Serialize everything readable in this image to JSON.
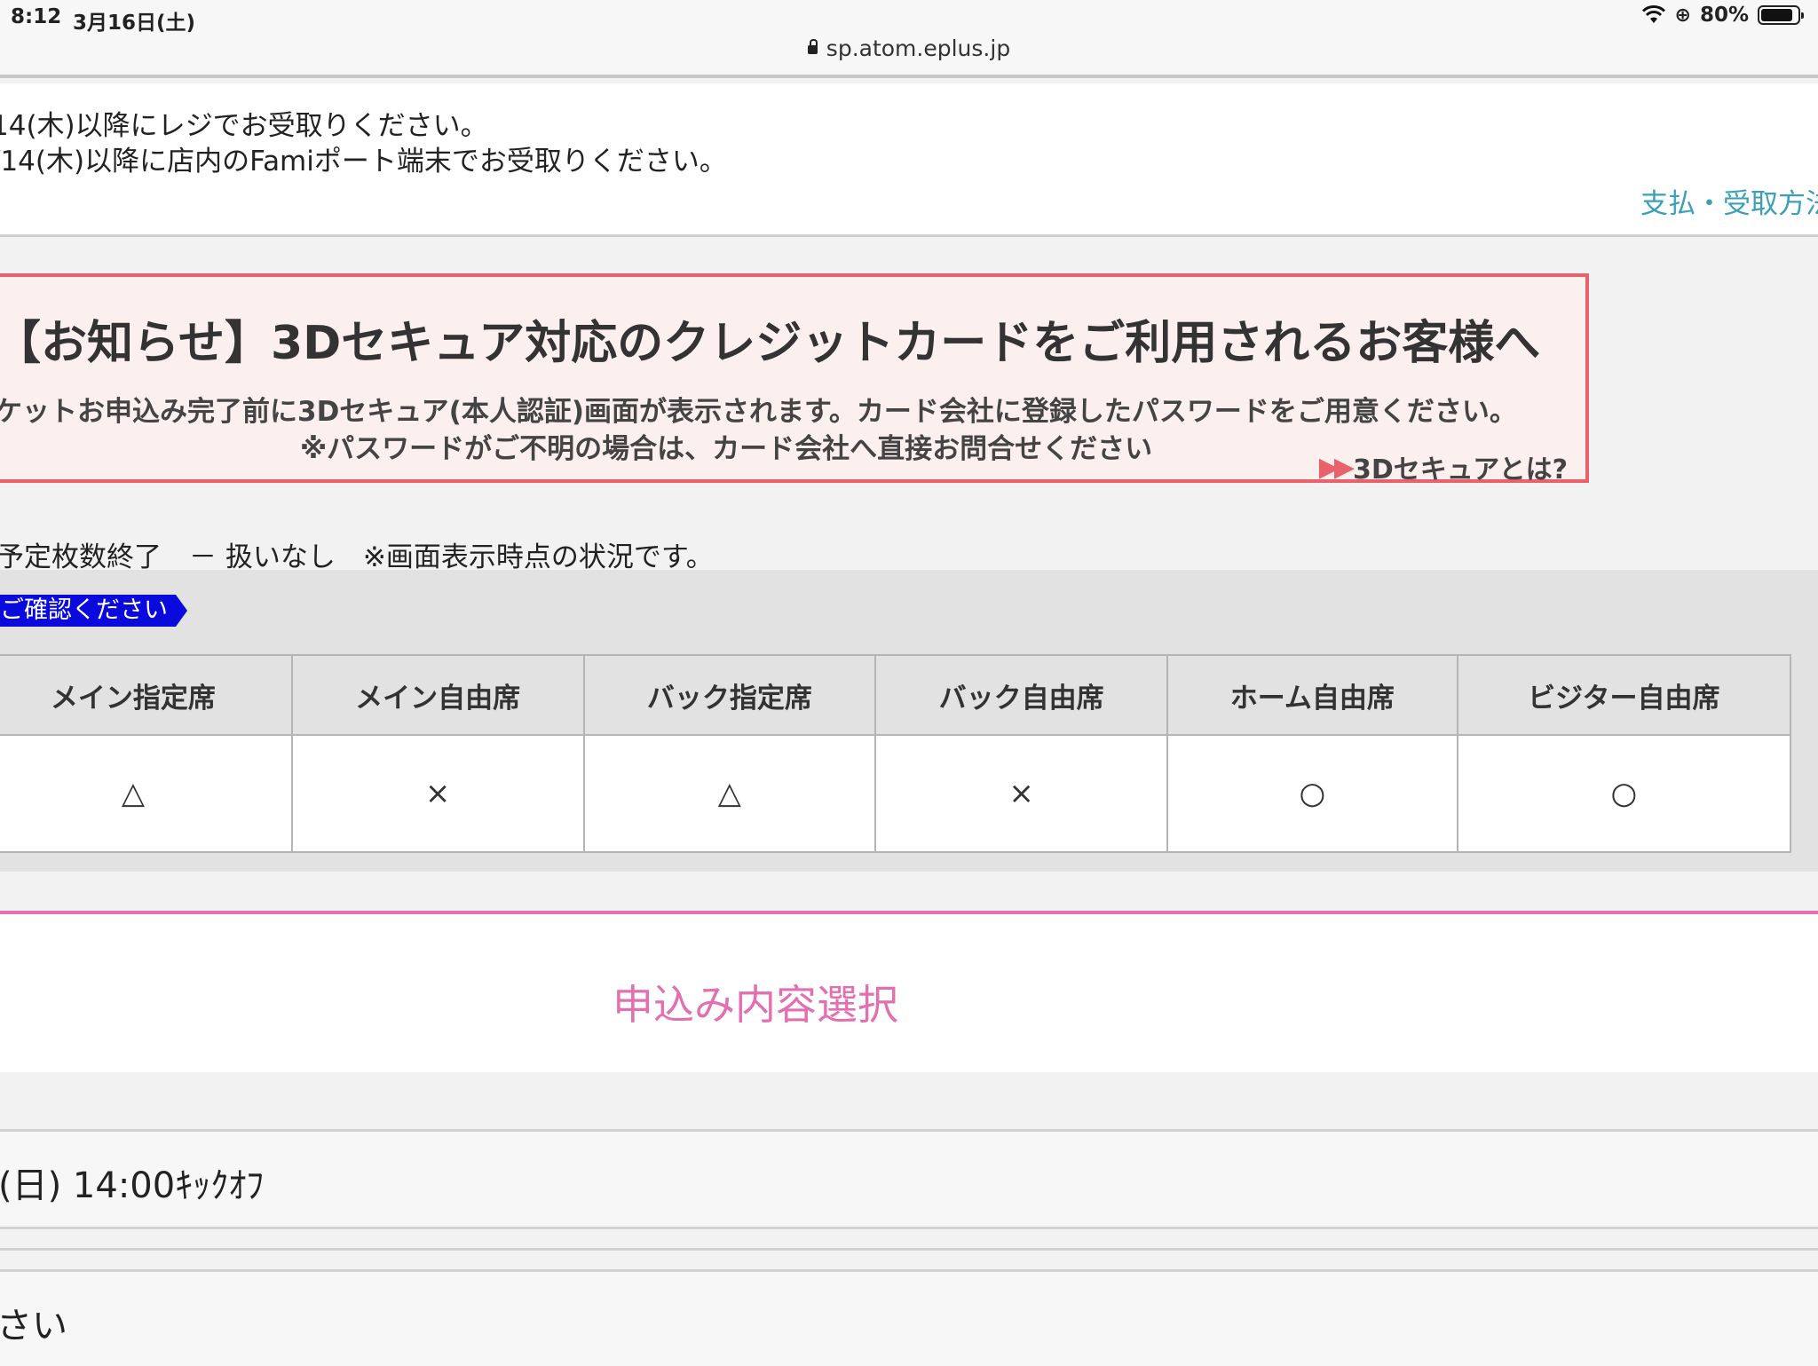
{
  "status_bar": {
    "time": "8:12",
    "date": "3月16日(土)",
    "url": "sp.atom.eplus.jp",
    "battery": "80%"
  },
  "pickup": {
    "line1": "14(木)以降にレジでお受取りください。",
    "line2": "/14(木)以降に店内のFamiポート端末でお受取りください。",
    "link": "支払・受取方法"
  },
  "notice": {
    "title": "【お知らせ】3Dセキュア対応のクレジットカードをご利用されるお客様へ",
    "body1": "ケットお申込み完了前に3Dセキュア(本人認証)画面が表示されます。カード会社に登録したパスワードをご用意ください。",
    "body2": "※パスワードがご不明の場合は、カード会社へ直接お問合せください",
    "link": "3Dセキュアとは?",
    "link_arrows": "▶▶"
  },
  "legend": "予定枚数終了　－ 扱いなし　※画面表示時点の状況です。",
  "confirm_badge": "ご確認ください",
  "seats": {
    "headers": [
      "メイン指定席",
      "メイン自由席",
      "バック指定席",
      "バック自由席",
      "ホーム自由席",
      "ビジター自由席"
    ],
    "status": [
      "△",
      "×",
      "△",
      "×",
      "○",
      "○"
    ]
  },
  "section": {
    "heading": "申込み内容選択"
  },
  "match_row": "(日) 14:00ｷｯｸｵﾌ",
  "bottom_row": "さい"
}
